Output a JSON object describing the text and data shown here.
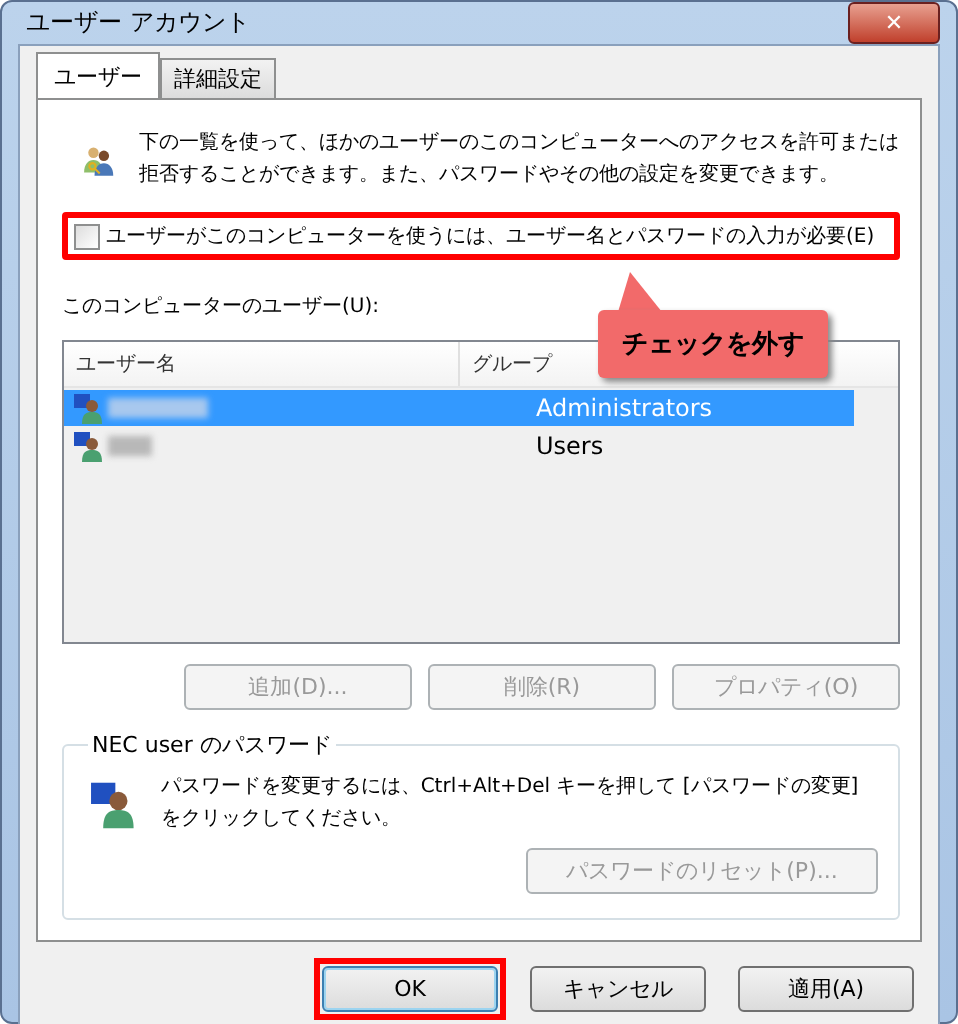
{
  "window": {
    "title": "ユーザー アカウント",
    "close": "✕"
  },
  "tabs": [
    {
      "label": "ユーザー",
      "selected": true
    },
    {
      "label": "詳細設定",
      "selected": false
    }
  ],
  "intro": "下の一覧を使って、ほかのユーザーのこのコンピューターへのアクセスを許可または拒否することができます。また、パスワードやその他の設定を変更できます。",
  "require_password": {
    "label": "ユーザーがこのコンピューターを使うには、ユーザー名とパスワードの入力が必要(E)",
    "checked": false,
    "highlighted": true
  },
  "callout": "チェックを外す",
  "users_label": "このコンピューターのユーザー(U):",
  "table": {
    "columns": [
      "ユーザー名",
      "グループ"
    ],
    "rows": [
      {
        "group": "Administrators",
        "selected": true
      },
      {
        "group": "Users",
        "selected": false
      }
    ]
  },
  "user_buttons": [
    {
      "label": "追加(D)...",
      "disabled": true
    },
    {
      "label": "削除(R)",
      "disabled": true
    },
    {
      "label": "プロパティ(O)",
      "disabled": true
    }
  ],
  "password_group": {
    "title": "NEC user のパスワード",
    "text": "パスワードを変更するには、Ctrl+Alt+Del キーを押して [パスワードの変更] をクリックしてください。",
    "button": {
      "label": "パスワードのリセット(P)...",
      "disabled": true
    }
  },
  "dialog_buttons": [
    {
      "label": "OK",
      "highlighted": true,
      "default": true
    },
    {
      "label": "キャンセル",
      "highlighted": false,
      "default": false
    },
    {
      "label": "適用(A)",
      "highlighted": false,
      "default": false
    }
  ]
}
